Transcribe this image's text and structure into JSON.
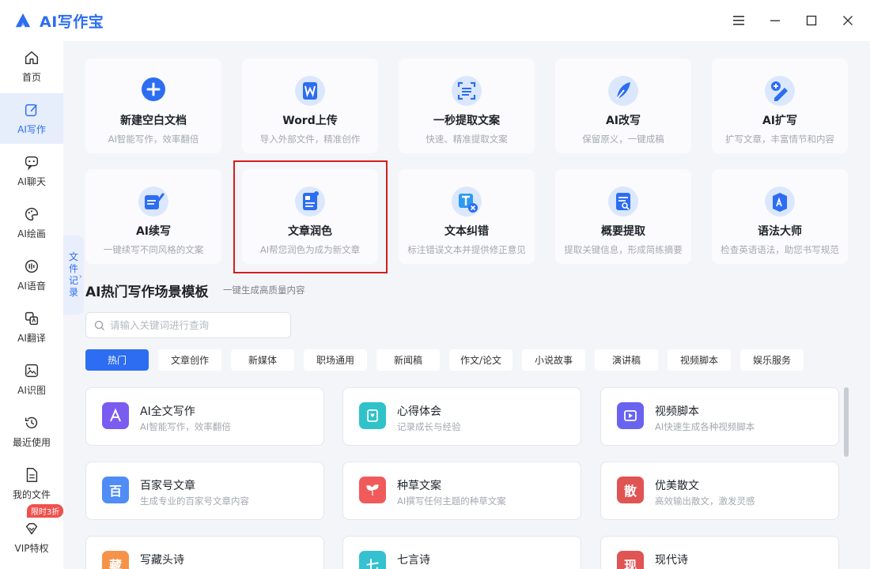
{
  "app": {
    "name": "AI写作宝"
  },
  "sidebar": {
    "items": [
      {
        "label": "首页",
        "icon": "home-icon"
      },
      {
        "label": "AI写作",
        "icon": "edit-icon"
      },
      {
        "label": "AI聊天",
        "icon": "chat-icon"
      },
      {
        "label": "AI绘画",
        "icon": "palette-icon"
      },
      {
        "label": "AI语音",
        "icon": "voice-icon"
      },
      {
        "label": "AI翻译",
        "icon": "translate-icon"
      },
      {
        "label": "AI识图",
        "icon": "image-icon"
      },
      {
        "label": "最近使用",
        "icon": "history-icon"
      },
      {
        "label": "我的文件",
        "icon": "file-icon"
      },
      {
        "label": "VIP特权",
        "icon": "diamond-icon",
        "badge": "限时3折"
      }
    ]
  },
  "file_records_tab": {
    "chars": [
      "文",
      "件",
      "记",
      "录"
    ]
  },
  "tools": [
    {
      "title": "新建空白文档",
      "desc": "AI智能写作，效率翻倍",
      "icon": "plus-circle-icon"
    },
    {
      "title": "Word上传",
      "desc": "导入外部文件，精准创作",
      "icon": "word-icon"
    },
    {
      "title": "一秒提取文案",
      "desc": "快速、精准提取文案",
      "icon": "scan-text-icon"
    },
    {
      "title": "AI改写",
      "desc": "保留原义，一键成稿",
      "icon": "feather-icon"
    },
    {
      "title": "AI扩写",
      "desc": "扩写文章，丰富情节和内容",
      "icon": "pen-plus-icon"
    },
    {
      "title": "AI续写",
      "desc": "一键续写不同风格的文案",
      "icon": "book-pen-icon"
    },
    {
      "title": "文章润色",
      "desc": "AI帮您润色为成为新文章",
      "icon": "document-polish-icon"
    },
    {
      "title": "文本纠错",
      "desc": "标注错误文本并提供修正意见",
      "icon": "text-correct-icon"
    },
    {
      "title": "概要提取",
      "desc": "提取关键信息，形成简练摘要",
      "icon": "summary-icon"
    },
    {
      "title": "语法大师",
      "desc": "检查英语语法，助您书写规范",
      "icon": "grammar-icon"
    }
  ],
  "templates_section": {
    "title": "AI热门写作场景模板",
    "subtitle": "一键生成高质量内容",
    "search_placeholder": "请输入关键词进行查询"
  },
  "categories": [
    "热门",
    "文章创作",
    "新媒体",
    "职场通用",
    "新闻稿",
    "作文/论文",
    "小说故事",
    "演讲稿",
    "视频脚本",
    "娱乐服务"
  ],
  "active_category": "热门",
  "templates": [
    {
      "title": "AI全文写作",
      "desc": "AI智能写作，效率翻倍",
      "icon": "ai-write-icon",
      "icon_text": "",
      "color": "#7b5cf0"
    },
    {
      "title": "心得体会",
      "desc": "记录成长与经验",
      "icon": "notebook-icon",
      "icon_text": "",
      "color": "#2fc3c9"
    },
    {
      "title": "视频脚本",
      "desc": "AI快速生成各种视频脚本",
      "icon": "video-icon",
      "icon_text": "",
      "color": "#6a63f0"
    },
    {
      "title": "百家号文章",
      "desc": "生成专业的百家号文章内容",
      "icon": "baijia-icon",
      "icon_text": "百",
      "color": "#4f8cf5"
    },
    {
      "title": "种草文案",
      "desc": "AI撰写任何主题的种草文案",
      "icon": "sprout-icon",
      "icon_text": "",
      "color": "#f05a5a"
    },
    {
      "title": "优美散文",
      "desc": "高效输出散文，激发灵感",
      "icon": "prose-icon",
      "icon_text": "散",
      "color": "#e05454"
    },
    {
      "title": "写藏头诗",
      "desc": "",
      "icon": "acrostic-icon",
      "icon_text": "藏",
      "color": "#f5934a"
    },
    {
      "title": "七言诗",
      "desc": "",
      "icon": "poem-icon",
      "icon_text": "七",
      "color": "#35c1cf"
    },
    {
      "title": "现代诗",
      "desc": "",
      "icon": "modern-poem-icon",
      "icon_text": "现",
      "color": "#e05454"
    }
  ]
}
